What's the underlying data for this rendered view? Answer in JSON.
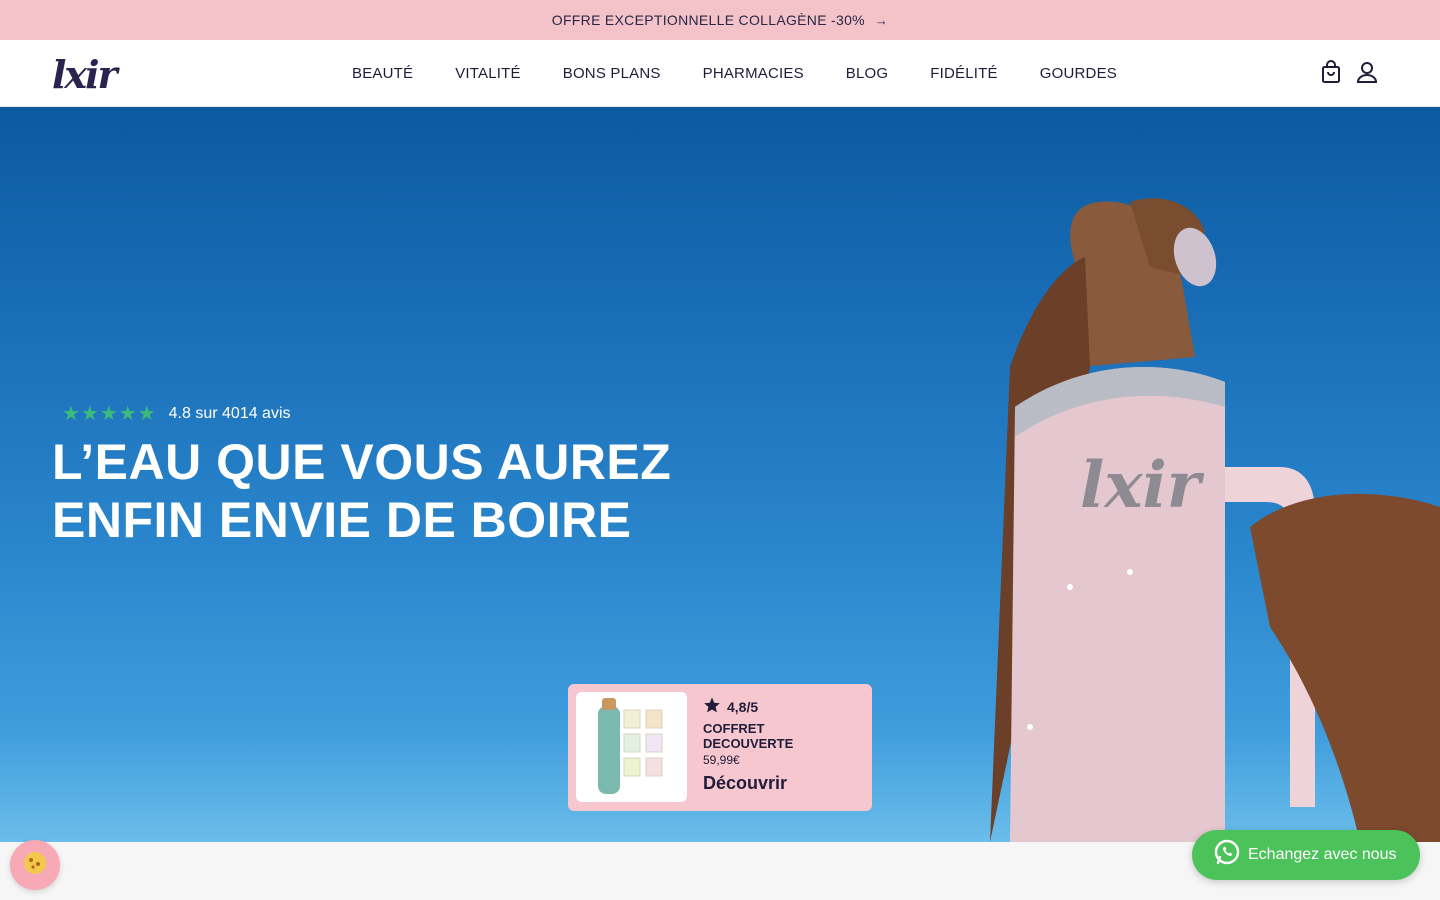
{
  "announcement": {
    "text": "OFFRE EXCEPTIONNELLE COLLAGÈNE -30%",
    "arrow": "→"
  },
  "header": {
    "logo": "lxir",
    "nav": [
      "BEAUTÉ",
      "VITALITÉ",
      "BONS PLANS",
      "PHARMACIES",
      "BLOG",
      "FIDÉLITÉ",
      "GOURDES"
    ],
    "icons": [
      "shopping-bag-icon",
      "account-icon"
    ]
  },
  "hero": {
    "rating_stars": "★★★★★",
    "rating_text": "4.8 sur 4014 avis",
    "title_line1": "L’EAU QUE VOUS AUREZ",
    "title_line2": "ENFIN ENVIE DE BOIRE",
    "bottle_logo": "lxir"
  },
  "promo_card": {
    "rating": "4,8/5",
    "name": "COFFRET DECOUVERTE",
    "price": "59,99€",
    "cta": "Découvrir"
  },
  "whatsapp": {
    "label": "Echangez avec nous"
  },
  "colors": {
    "announcement_bg": "#f3c3c9",
    "star_green": "#3dbb7c",
    "promo_bg": "#f7c7cf",
    "whatsapp_green": "#4cc35a",
    "brand_dark": "#2a2350"
  }
}
